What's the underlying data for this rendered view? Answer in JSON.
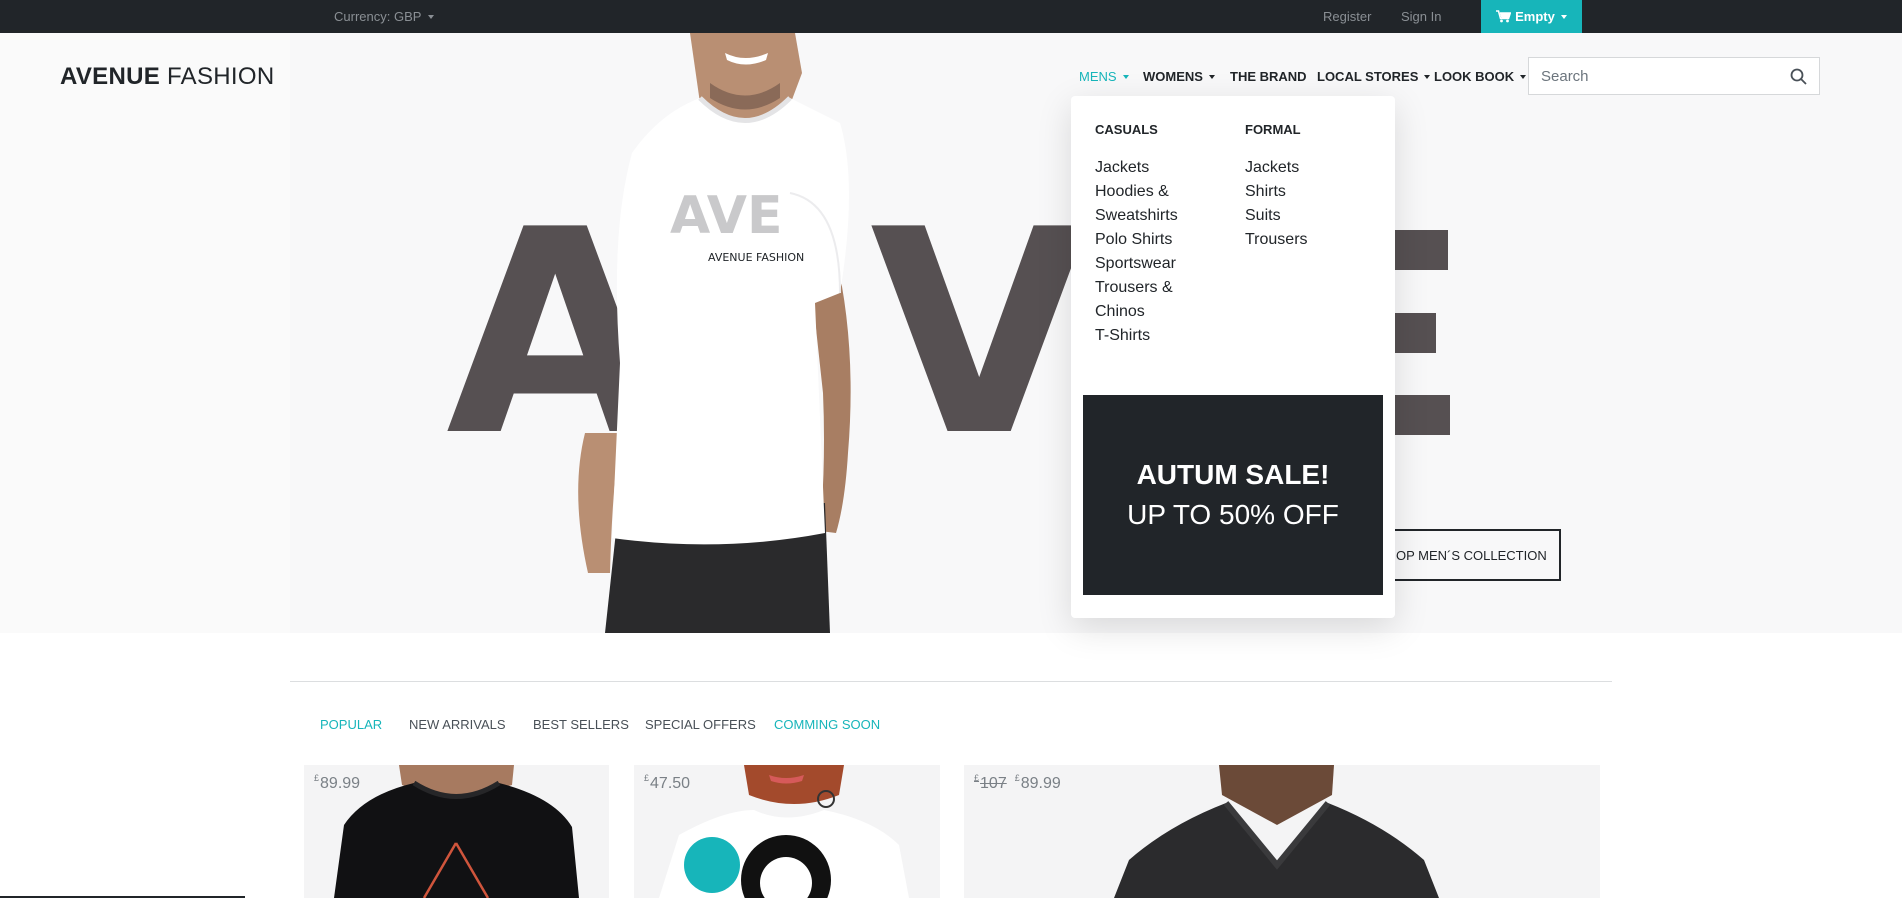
{
  "topbar": {
    "currency_label": "Currency: GBP",
    "register": "Register",
    "signin": "Sign In",
    "cart_label": "Empty"
  },
  "header": {
    "brand_bold": "AVENUE",
    "brand_light": "FASHION",
    "nav": {
      "mens": "MENS",
      "womens": "WOMENS",
      "brand": "THE BRAND",
      "stores": "LOCAL STORES",
      "lookbook": "LOOK BOOK"
    },
    "search_placeholder": "Search"
  },
  "hero": {
    "letter_a": "A",
    "letter_v": "V",
    "shirt_letters": "AVE",
    "shirt_caption": "AVENUE FASHION",
    "button_label": "OP MEN´S COLLECTION"
  },
  "mega_menu": {
    "casuals_title": "CASUALS",
    "casuals": [
      "Jackets",
      "Hoodies &",
      "Sweatshirts",
      "Polo Shirts",
      "Sportswear",
      "Trousers &",
      "Chinos",
      "T-Shirts"
    ],
    "formal_title": "FORMAL",
    "formal": [
      "Jackets",
      "Shirts",
      "Suits",
      "Trousers"
    ],
    "promo_line1": "AUTUM SALE!",
    "promo_line2": "UP TO 50% OFF"
  },
  "tabs": {
    "popular": "POPULAR",
    "new_arrivals": "NEW ARRIVALS",
    "best_sellers": "BEST SELLERS",
    "special_offers": "SPECIAL OFFERS",
    "coming_soon": "COMMING SOON"
  },
  "products": [
    {
      "currency": "£",
      "price": "89.99"
    },
    {
      "currency": "£",
      "price": "47.50"
    },
    {
      "currency": "£",
      "old_price": "107",
      "price": "89.99"
    }
  ],
  "colors": {
    "accent": "#17b5ba",
    "dark": "#212529",
    "hero_letters": "#565052"
  }
}
